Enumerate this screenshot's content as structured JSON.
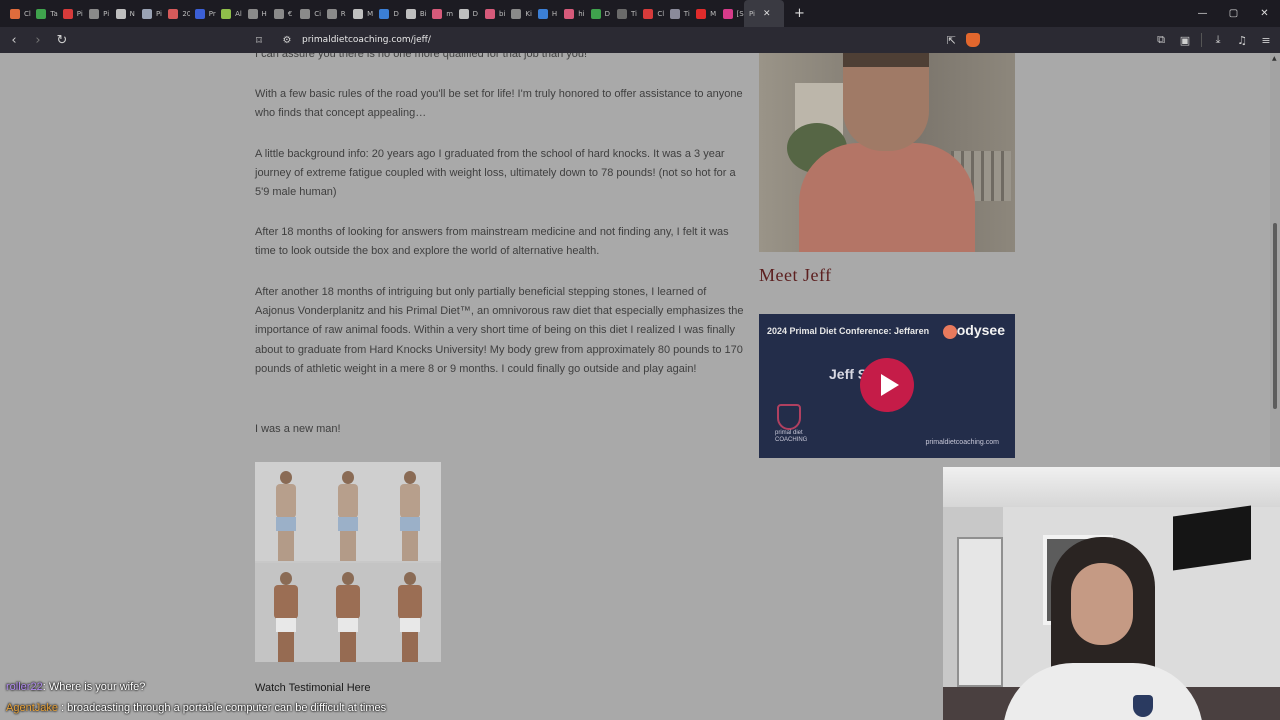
{
  "browser": {
    "tabs": [
      {
        "label": "Cl",
        "color": "#e06c3c"
      },
      {
        "label": "Ta",
        "color": "#3fa34d"
      },
      {
        "label": "Pi",
        "color": "#d63b3b"
      },
      {
        "label": "Pi",
        "color": "#8a8a8a"
      },
      {
        "label": "N",
        "color": "#bfbfbf"
      },
      {
        "label": "Pi",
        "color": "#9aa3b5"
      },
      {
        "label": "20",
        "color": "#d65a5a"
      },
      {
        "label": "Pr",
        "color": "#3b5fd6"
      },
      {
        "label": "Al",
        "color": "#8fbf4a"
      },
      {
        "label": "H",
        "color": "#8a8a8a"
      },
      {
        "label": "€",
        "color": "#8a8a8a"
      },
      {
        "label": "Ci",
        "color": "#8a8a8a"
      },
      {
        "label": "R",
        "color": "#8a8a8a"
      },
      {
        "label": "M",
        "color": "#bfbfbf"
      },
      {
        "label": "D",
        "color": "#3b7fd6"
      },
      {
        "label": "Bi",
        "color": "#bfbfbf"
      },
      {
        "label": "m",
        "color": "#d65a7a"
      },
      {
        "label": "D",
        "color": "#bfbfbf"
      },
      {
        "label": "bi",
        "color": "#d65a7a"
      },
      {
        "label": "Ki",
        "color": "#8a8a8a"
      },
      {
        "label": "H",
        "color": "#3b7fd6"
      },
      {
        "label": "hi",
        "color": "#d65a7a"
      },
      {
        "label": "D",
        "color": "#3fa34d"
      },
      {
        "label": "Ti",
        "color": "#6a6a6a"
      },
      {
        "label": "Cl",
        "color": "#d63b3b"
      },
      {
        "label": "Ti",
        "color": "#8a8a9a"
      },
      {
        "label": "M",
        "color": "#e02b2b"
      },
      {
        "label": "[S",
        "color": "#d63b8a"
      }
    ],
    "active_tab": {
      "label": "Pi",
      "close": "✕"
    },
    "new_tab": "+",
    "window_controls": {
      "minimize": "—",
      "maximize": "▢",
      "close": "✕"
    },
    "nav": {
      "back": "‹",
      "forward": "›",
      "reload": "↻"
    },
    "url": "primaldietcoaching.com/jeff/"
  },
  "article": {
    "p0": "I can assure you there is no one more qualified for that job than you!",
    "p1": "With a few basic rules of the road you'll be set for life! I'm truly honored to offer assistance to anyone who finds that concept appealing…",
    "p2": "A little background info: 20 years ago I graduated from the school of hard knocks. It was a 3 year journey of extreme fatigue coupled with weight loss, ultimately down to 78 pounds! (not so hot for a 5'9 male human)",
    "p3": "After 18 months of looking for answers from mainstream medicine and not finding any, I felt it was time to look outside the box and explore the world of alternative health.",
    "p4": "After another 18 months of intriguing but only partially beneficial stepping stones, I learned of Aajonus Vonderplanitz and his Primal Diet™, an omnivorous raw diet that especially emphasizes the importance of raw animal foods. Within a very short time of being on this diet I realized I was finally about to graduate from Hard Knocks University! My body grew from approximately 80 pounds to 170 pounds of athletic weight in a mere 8 or 9 months. I could finally go outside and play again!",
    "p5": "I was a new man!",
    "testimonial_link": "Watch Testimonial Here"
  },
  "sidebar": {
    "meet_jeff": "Meet Jeff",
    "odysee": {
      "video_title": "2024 Primal Diet Conference: Jeffaren",
      "brand": "odysee",
      "headline": "Jeff S     Story",
      "logo_text": "primal diet\nCOACHING",
      "site": "primaldietcoaching.com"
    }
  },
  "chat": [
    {
      "user": "roller22",
      "sep": ": ",
      "message": "Where is your wife?"
    },
    {
      "user": "AgentJake",
      "sep": " : ",
      "message": "broadcasting through a portable computer can be difficult at times"
    }
  ]
}
